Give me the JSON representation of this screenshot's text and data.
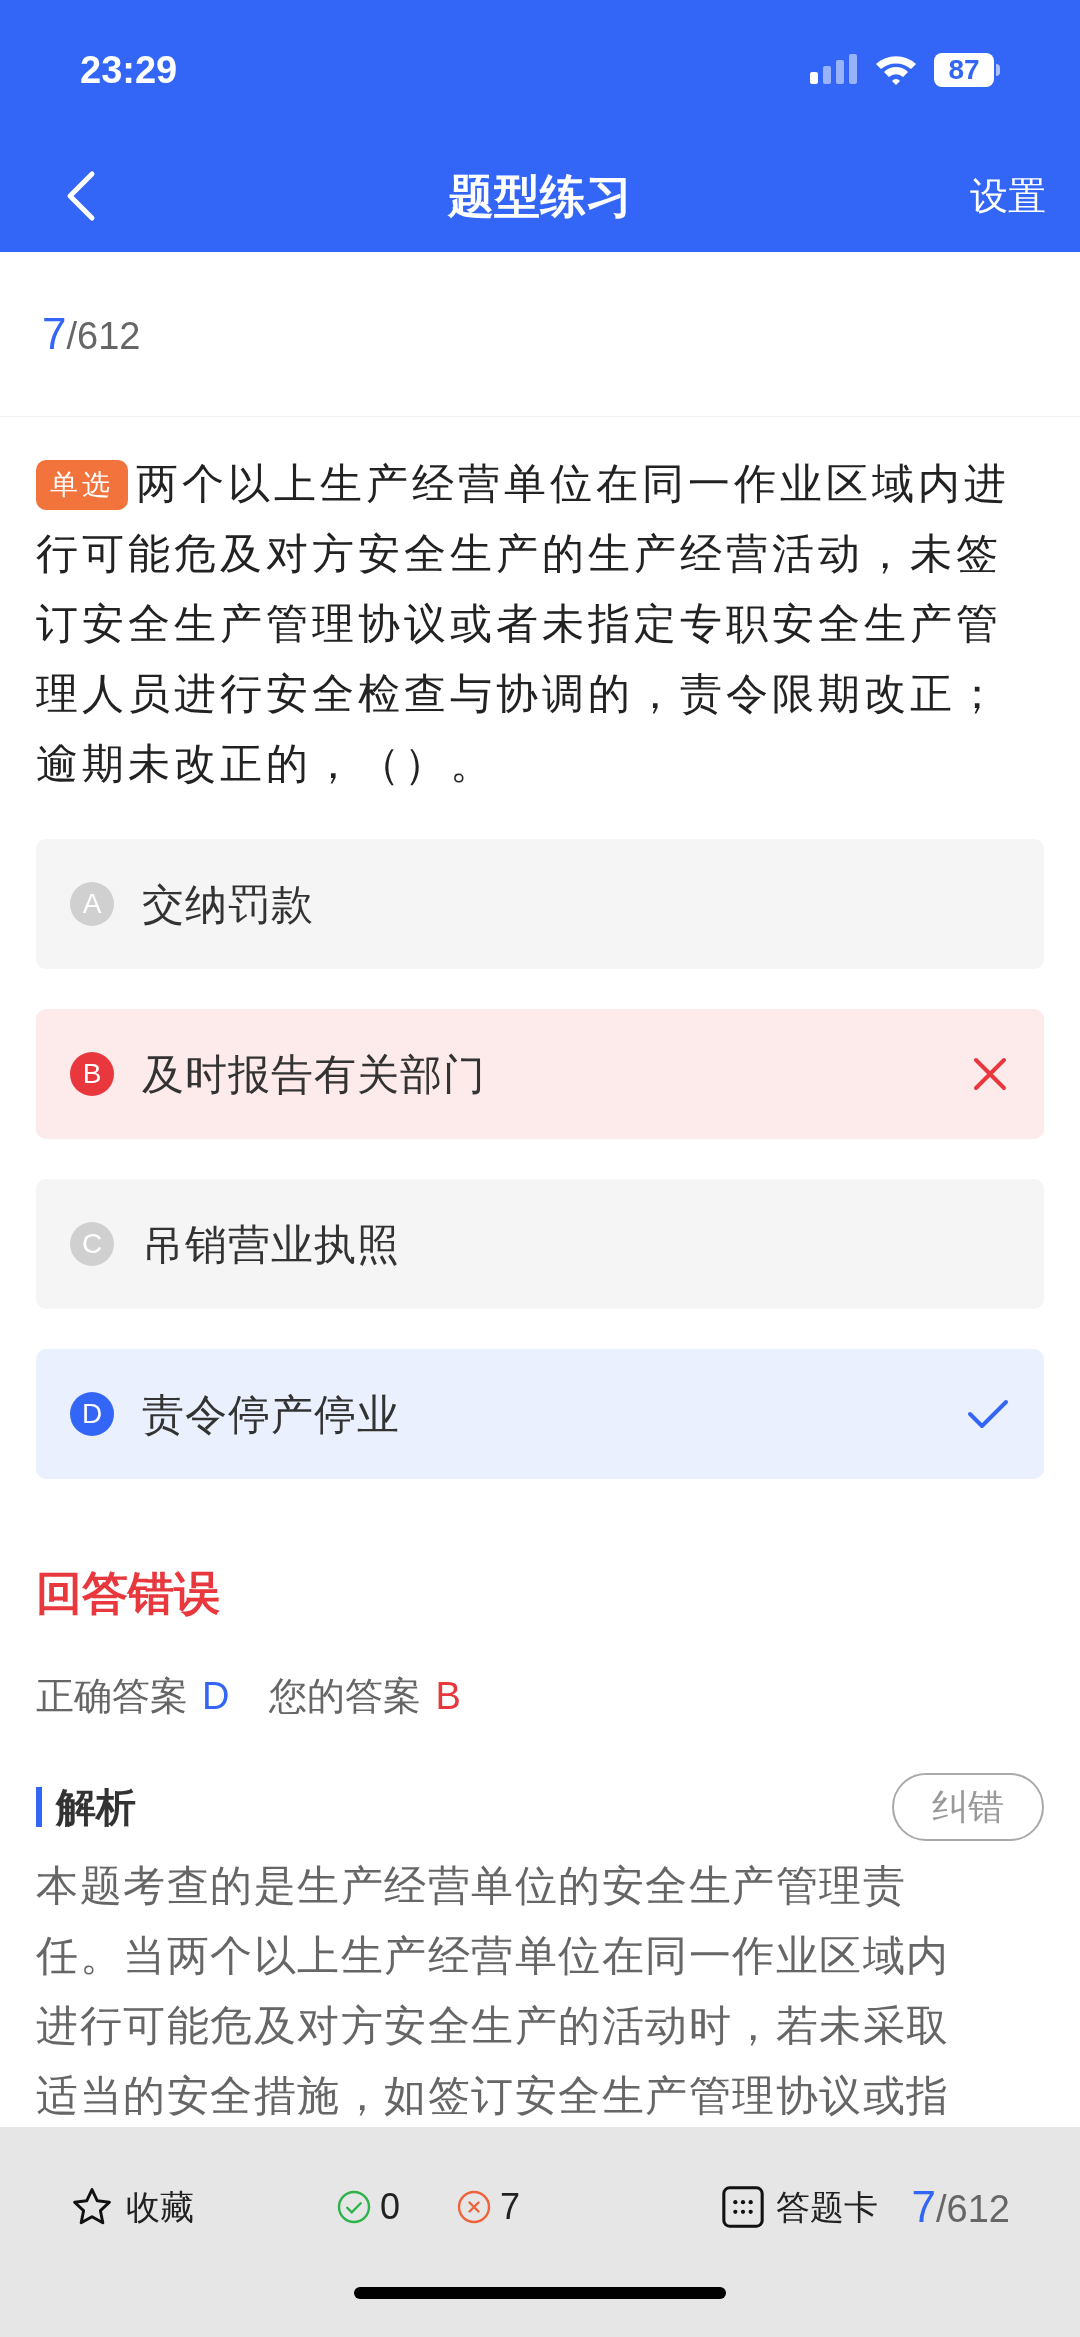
{
  "status_bar": {
    "time": "23:29",
    "battery": "87"
  },
  "header": {
    "title": "题型练习",
    "action": "设置"
  },
  "progress": {
    "current": "7",
    "total": "/612"
  },
  "question": {
    "type_badge": "单选",
    "text": "两个以上生产经营单位在同一作业区域内进行可能危及对方安全生产的生产经营活动，未签订安全生产管理协议或者未指定专职安全生产管理人员进行安全检查与协调的，责令限期改正；逾期未改正的，（）。"
  },
  "options": [
    {
      "letter": "A",
      "text": "交纳罚款",
      "selected": false,
      "correct": false
    },
    {
      "letter": "B",
      "text": "及时报告有关部门",
      "selected": true,
      "correct": false
    },
    {
      "letter": "C",
      "text": "吊销营业执照",
      "selected": false,
      "correct": false
    },
    {
      "letter": "D",
      "text": "责令停产停业",
      "selected": false,
      "correct": true
    }
  ],
  "verdict": "回答错误",
  "answers": {
    "correct_label": "正确答案",
    "correct": "D",
    "yours_label": "您的答案",
    "yours": "B"
  },
  "analysis": {
    "title": "解析",
    "report_button": "纠错",
    "lines": [
      "本题考查的是生产经营单位的安全生产管理责",
      "任。当两个以上生产经营单位在同一作业区域内",
      "进行可能危及对方安全生产的活动时，若未采取",
      "适当的安全措施，如签订安全生产管理协议或指"
    ]
  },
  "bottom_bar": {
    "favorite": "收藏",
    "right_count": "0",
    "wrong_count": "7",
    "answer_card": "答题卡",
    "current": "7",
    "total": "/612"
  }
}
